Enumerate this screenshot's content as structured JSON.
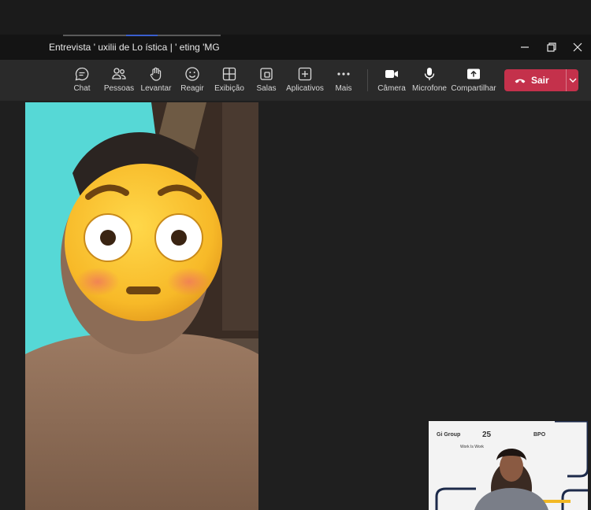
{
  "window": {
    "title": "Entrevista ' uxilii  de Lo ística | ' eting  'MG"
  },
  "window_controls": {
    "minimize_icon": "minimize-icon",
    "restore_icon": "restore-icon",
    "close_icon": "close-icon"
  },
  "toolbar": {
    "items": [
      {
        "label": "Chat",
        "icon": "chat-icon"
      },
      {
        "label": "Pessoas",
        "icon": "people-icon"
      },
      {
        "label": "Levantar",
        "icon": "raise-hand-icon"
      },
      {
        "label": "Reagir",
        "icon": "react-icon"
      },
      {
        "label": "Exibição",
        "icon": "view-icon"
      },
      {
        "label": "Salas",
        "icon": "rooms-icon"
      },
      {
        "label": "Aplicativos",
        "icon": "apps-icon"
      },
      {
        "label": "Mais",
        "icon": "more-icon"
      },
      {
        "label": "Câmera",
        "icon": "camera-icon"
      },
      {
        "label": "Microfone",
        "icon": "microphone-icon"
      },
      {
        "label": "Compartilhar",
        "icon": "share-icon"
      }
    ],
    "leave_label": "Sair"
  },
  "colors": {
    "leave_button": "#c4314b",
    "toolbar_bg": "#2a2a2a",
    "stage_bg": "#1f1f1f"
  },
  "self_view": {
    "brand_left": "Gi Group",
    "brand_mid": "25",
    "brand_right": "BPO",
    "tagline": "Work Is Work"
  }
}
